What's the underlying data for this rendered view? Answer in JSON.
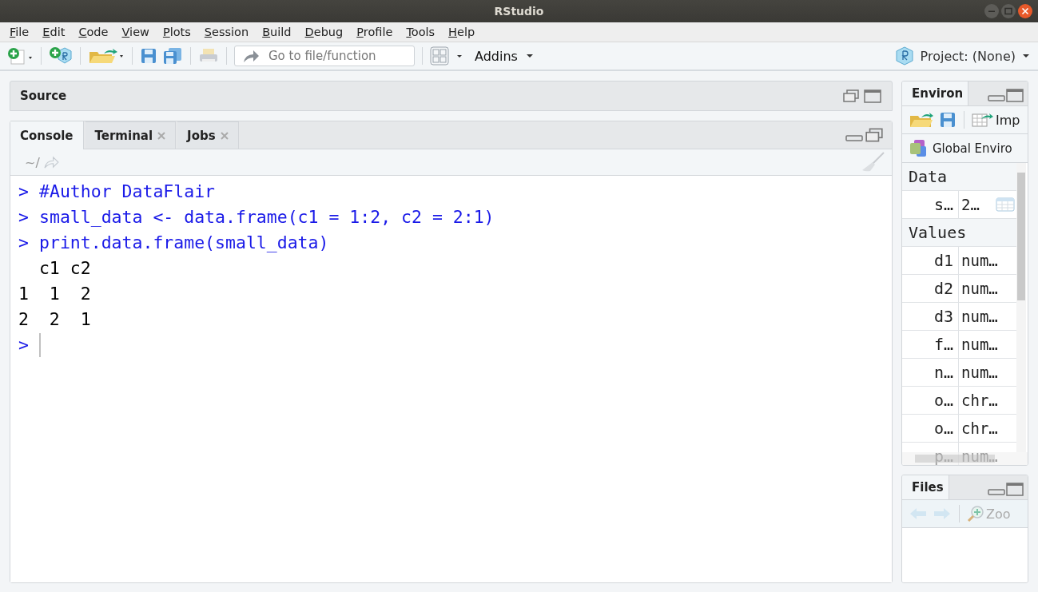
{
  "window": {
    "title": "RStudio"
  },
  "menu": [
    "File",
    "Edit",
    "Code",
    "View",
    "Plots",
    "Session",
    "Build",
    "Debug",
    "Profile",
    "Tools",
    "Help"
  ],
  "toolbar": {
    "search": {
      "placeholder": "Go to file/function"
    },
    "addins": "Addins",
    "project": "Project: (None)"
  },
  "source_pane": {
    "title": "Source"
  },
  "console_pane": {
    "tabs": [
      {
        "label": "Console",
        "selected": true,
        "closable": false
      },
      {
        "label": "Terminal",
        "selected": false,
        "closable": true
      },
      {
        "label": "Jobs",
        "selected": false,
        "closable": true
      }
    ],
    "path": "~/",
    "lines": [
      {
        "kind": "input",
        "prompt": ">",
        "text": "#Author DataFlair"
      },
      {
        "kind": "input",
        "prompt": ">",
        "text": "small_data <- data.frame(c1 = 1:2, c2 = 2:1)"
      },
      {
        "kind": "input",
        "prompt": ">",
        "text": "print.data.frame(small_data)"
      },
      {
        "kind": "output",
        "text": "  c1 c2"
      },
      {
        "kind": "output",
        "text": "1  1  2"
      },
      {
        "kind": "output",
        "text": "2  2  1"
      },
      {
        "kind": "cursor",
        "prompt": ">"
      }
    ]
  },
  "environment_pane": {
    "tabs": [
      {
        "label": "Environ",
        "selected": true
      }
    ],
    "import_label": "Imp",
    "scope": "Global Enviro",
    "sections": [
      {
        "title": "Data",
        "rows": [
          {
            "name": "s…",
            "value": "2…",
            "kind": "data"
          }
        ]
      },
      {
        "title": "Values",
        "rows": [
          {
            "name": "d1",
            "value": "num…",
            "kind": "value"
          },
          {
            "name": "d2",
            "value": "num…",
            "kind": "value"
          },
          {
            "name": "d3",
            "value": "num…",
            "kind": "value"
          },
          {
            "name": "f…",
            "value": "num…",
            "kind": "value"
          },
          {
            "name": "n…",
            "value": "num…",
            "kind": "value"
          },
          {
            "name": "o…",
            "value": "chr…",
            "kind": "value"
          },
          {
            "name": "o…",
            "value": "chr…",
            "kind": "value"
          },
          {
            "name": "p…",
            "value": "num…",
            "kind": "value"
          }
        ]
      }
    ]
  },
  "files_pane": {
    "tabs": [
      {
        "label": "Files",
        "selected": true
      }
    ],
    "zoom_label": "Zoo"
  }
}
